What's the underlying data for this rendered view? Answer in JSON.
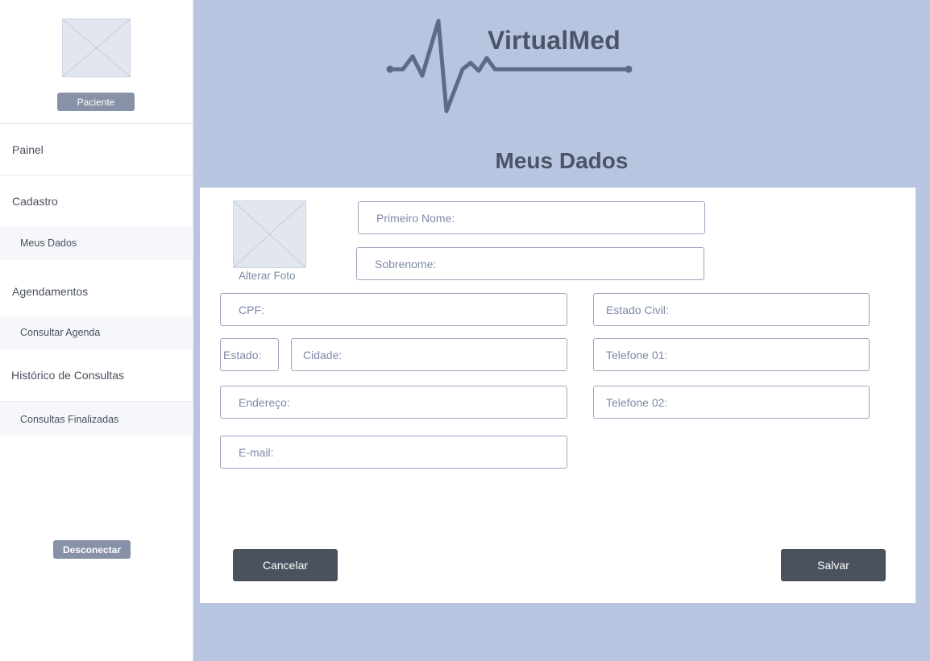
{
  "sidebar": {
    "role_label": "Paciente",
    "items": [
      {
        "label": "Painel"
      },
      {
        "label": "Cadastro"
      },
      {
        "label": "Meus Dados"
      },
      {
        "label": "Agendamentos"
      },
      {
        "label": "Consultar Agenda"
      },
      {
        "label": "Histórico de Consultas"
      },
      {
        "label": "Consultas Finalizadas"
      }
    ],
    "logout_label": "Desconectar"
  },
  "header": {
    "brand": "VirtualMed",
    "page_title": "Meus Dados"
  },
  "form": {
    "photo_label": "Alterar Foto",
    "fields": {
      "first_name": "Primeiro Nome:",
      "last_name": "Sobrenome:",
      "cpf": "CPF:",
      "marital_status": "Estado Civil:",
      "state": "Estado:",
      "city": "Cidade:",
      "phone1": "Telefone 01:",
      "address": "Endereço:",
      "phone2": "Telefone 02:",
      "email": "E-mail:"
    },
    "cancel_label": "Cancelar",
    "save_label": "Salvar"
  },
  "colors": {
    "background": "#b8c5e1",
    "button_dark": "#4a5260",
    "badge": "#8792a8",
    "logo_line": "#5a6b8c"
  },
  "icons": [
    "image-placeholder-icon",
    "heartbeat-logo-icon"
  ]
}
